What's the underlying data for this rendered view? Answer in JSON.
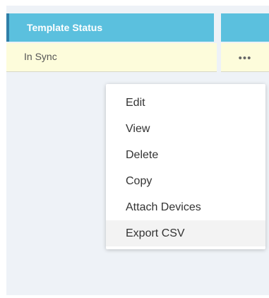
{
  "table": {
    "headers": {
      "template_status": "Template Status",
      "actions": ""
    },
    "rows": [
      {
        "template_status": "In Sync",
        "actions_icon": "•••"
      }
    ]
  },
  "context_menu": {
    "items": [
      {
        "label": "Edit"
      },
      {
        "label": "View"
      },
      {
        "label": "Delete"
      },
      {
        "label": "Copy"
      },
      {
        "label": "Attach Devices"
      },
      {
        "label": "Export CSV",
        "hovered": true
      }
    ]
  },
  "colors": {
    "header_bg": "#5bc0de",
    "row_bg": "#fdfcdb",
    "panel_bg": "#eef2f7"
  }
}
